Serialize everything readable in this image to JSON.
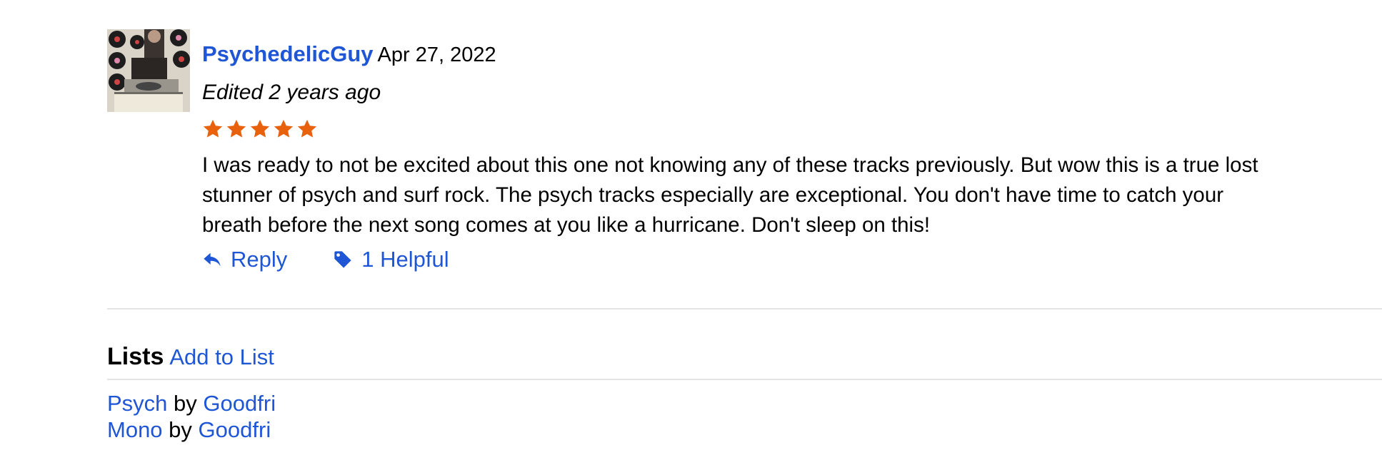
{
  "review": {
    "username": "PsychedelicGuy",
    "date": "Apr 27, 2022",
    "edited": "Edited 2 years ago",
    "rating": 5,
    "rating_max": 5,
    "star_color": "#e8620e",
    "text": "I was ready to not be excited about this one not knowing any of these tracks previously. But wow this is a true lost stunner of psych and surf rock. The psych tracks especially are exceptional. You don't have time to catch your breath before the next song comes at you like a hurricane. Don't sleep on this!",
    "reply_label": "Reply",
    "reply_icon": "reply-arrow-icon",
    "helpful_label": "1 Helpful",
    "helpful_icon": "tag-icon"
  },
  "lists": {
    "title": "Lists",
    "add_label": "Add to List",
    "by_word": "by",
    "items": [
      {
        "name": "Psych",
        "author": "Goodfri"
      },
      {
        "name": "Mono",
        "author": "Goodfri"
      }
    ]
  },
  "colors": {
    "link": "#1f56d6",
    "divider": "#e4e4e4"
  }
}
